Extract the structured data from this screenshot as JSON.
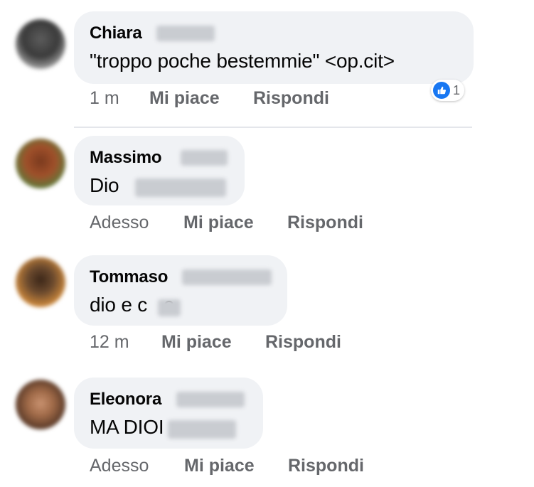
{
  "comments": [
    {
      "author": "Chiara",
      "text": "\"troppo poche bestemmie\" <op.cit>",
      "time": "1 m",
      "like_label": "Mi piace",
      "reply_label": "Rispondi",
      "reaction_count": "1",
      "reaction_icon": "like-icon"
    },
    {
      "author": "Massimo",
      "text": "Dio",
      "time": "Adesso",
      "like_label": "Mi piace",
      "reply_label": "Rispondi"
    },
    {
      "author": "Tommaso",
      "text": "dio e c   e",
      "time": "12 m",
      "like_label": "Mi piace",
      "reply_label": "Rispondi"
    },
    {
      "author": "Eleonora",
      "text": "MA DIOI",
      "time": "Adesso",
      "like_label": "Mi piace",
      "reply_label": "Rispondi"
    }
  ],
  "colors": {
    "bubble": "#f0f2f5",
    "meta_text": "#65676b",
    "like_blue": "#1877f2"
  }
}
